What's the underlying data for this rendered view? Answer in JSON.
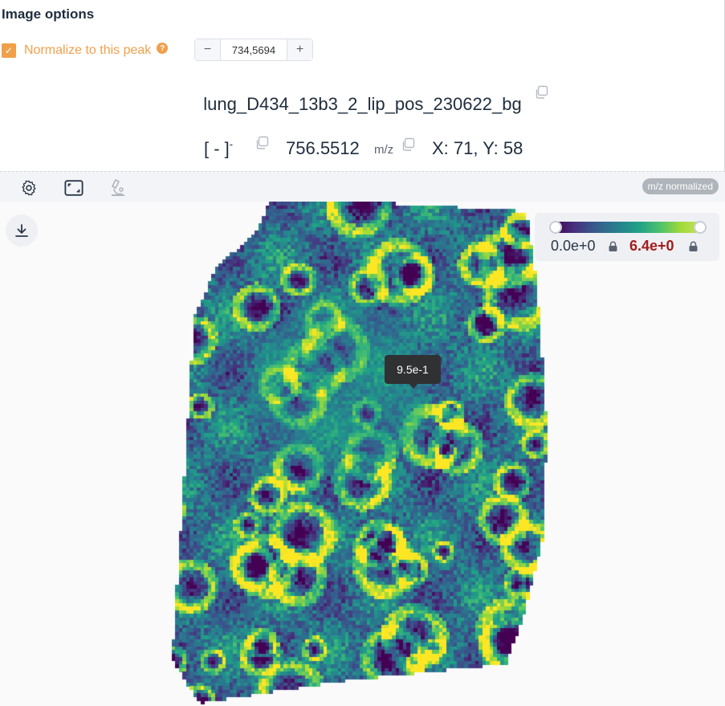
{
  "options": {
    "title": "Image options",
    "normalize_label": "Normalize to this peak",
    "normalize_checked": true,
    "help_symbol": "?",
    "stepper": {
      "minus": "−",
      "value": "734,5694",
      "plus": "+"
    }
  },
  "ion": {
    "dataset_name": "lung_D434_13b3_2_lip_pos_230622_bg",
    "formula": "[ - ]",
    "charge": "-",
    "mz": "756.5512",
    "mz_unit": "m/z",
    "coordinates": "X: 71, Y: 58"
  },
  "toolbar": {
    "icons": [
      "gear-icon",
      "fit-screen-icon",
      "microscope-icon"
    ],
    "badge": "m/z normalized"
  },
  "colorbar": {
    "min": "0.0e+0",
    "max": "6.4e+0",
    "colormap": "viridis",
    "min_color": "#2d3748",
    "max_color": "#a11d1d"
  },
  "tooltip": {
    "value": "9.5e-1"
  },
  "colors": {
    "accent": "#f0a04b",
    "toolbar_bg": "#f3f4f7",
    "tooltip_bg": "#303133"
  }
}
